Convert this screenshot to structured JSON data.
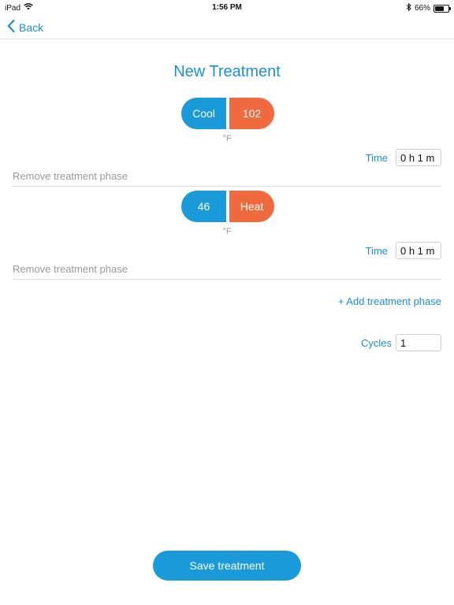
{
  "status_bar": {
    "device": "iPad",
    "time": "1:56 PM",
    "battery": "66%",
    "battery_level": 0.66
  },
  "nav": {
    "back_label": "Back"
  },
  "page": {
    "title": "New Treatment"
  },
  "phases": [
    {
      "left_label": "Cool",
      "right_label": "102",
      "unit": "°F",
      "time_label": "Time",
      "time_value": "0 h 1 m",
      "remove_label": "Remove treatment phase"
    },
    {
      "left_label": "46",
      "right_label": "Heat",
      "unit": "°F",
      "time_label": "Time",
      "time_value": "0 h 1 m",
      "remove_label": "Remove treatment phase"
    }
  ],
  "add_phase_label": "+ Add treatment phase",
  "cycles": {
    "label": "Cycles",
    "value": "1"
  },
  "save_label": "Save treatment",
  "colors": {
    "accent_blue": "#1a8fd6",
    "cool_blue": "#1a9ad8",
    "heat_orange": "#f06a3f"
  }
}
